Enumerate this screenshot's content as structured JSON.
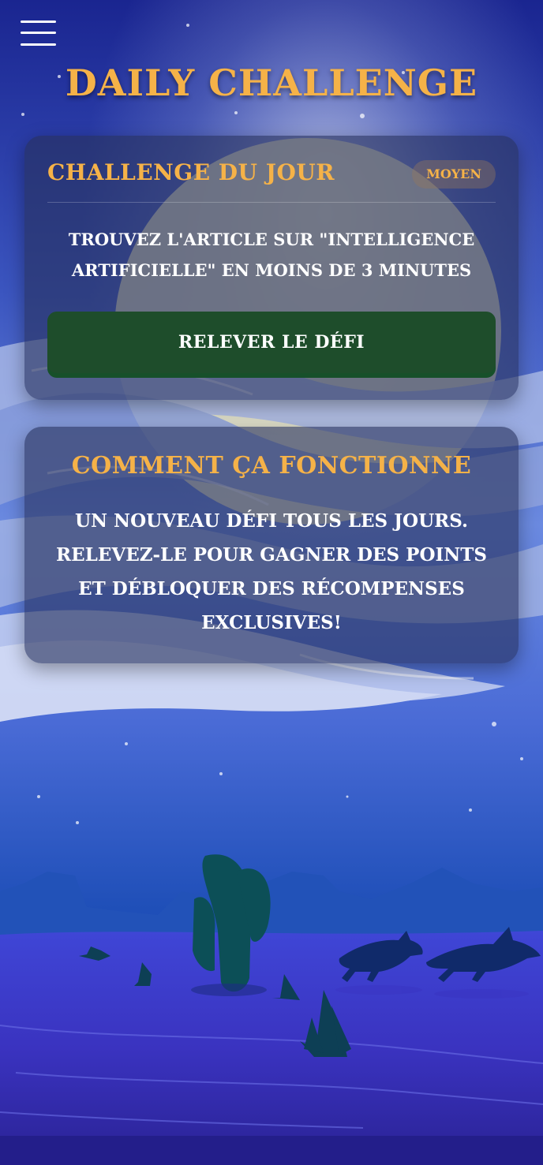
{
  "header": {
    "menu_icon": "hamburger-menu-icon",
    "title": "DAILY CHALLENGE"
  },
  "challenge_card": {
    "title": "CHALLENGE DU JOUR",
    "difficulty": "MOYEN",
    "description": "TROUVEZ L'ARTICLE SUR \"INTELLIGENCE ARTIFICIELLE\" EN MOINS DE 3 MINUTES",
    "button_label": "RELEVER LE DÉFI"
  },
  "how_card": {
    "title": "COMMENT ÇA FONCTIONNE",
    "description": "UN NOUVEAU DÉFI TOUS LES JOURS. RELEVEZ-LE POUR GAGNER DES POINTS ET DÉBLOQUER DES RÉCOMPENSES EXCLUSIVES!"
  },
  "colors": {
    "accent": "#f5b248",
    "button": "#1e4d2b",
    "sky_top": "#1a2a8a",
    "moon": "#f3efc7",
    "desert": "#3b3fd0"
  }
}
